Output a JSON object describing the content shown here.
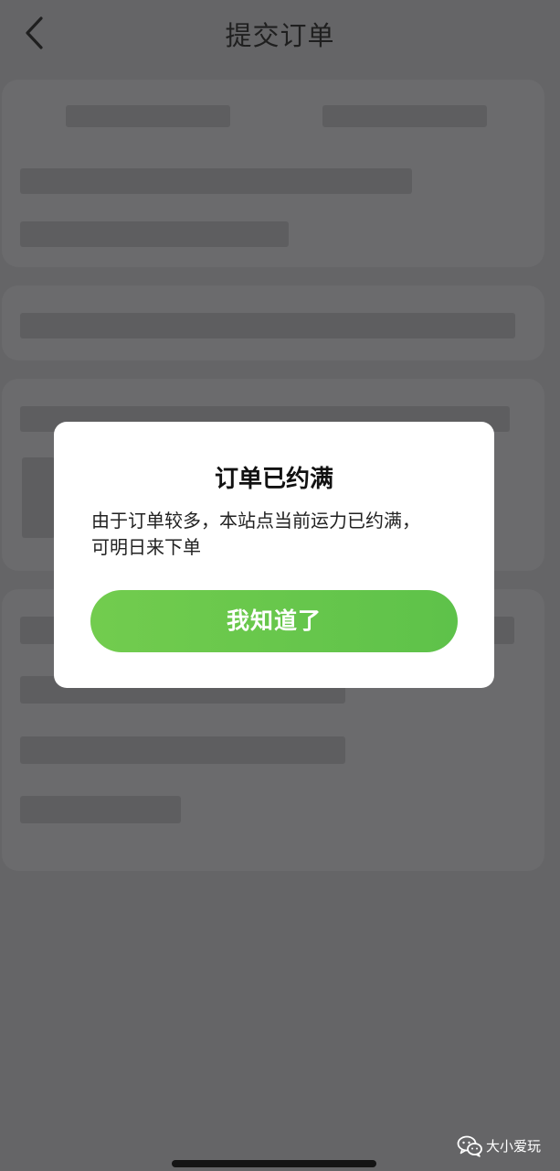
{
  "nav": {
    "title": "提交订单",
    "back_icon": "chevron-left-icon"
  },
  "dialog": {
    "title": "订单已约满",
    "message_line1": "由于订单较多，本站点当前运力已约满，",
    "message_line2": "可明日来下单",
    "button_label": "我知道了"
  },
  "watermark": {
    "icon": "wechat-icon",
    "text": "大小爱玩"
  },
  "colors": {
    "overlay": "#656567",
    "button_green_start": "#72cc4e",
    "button_green_end": "#5ec24a",
    "dialog_bg": "#ffffff"
  }
}
